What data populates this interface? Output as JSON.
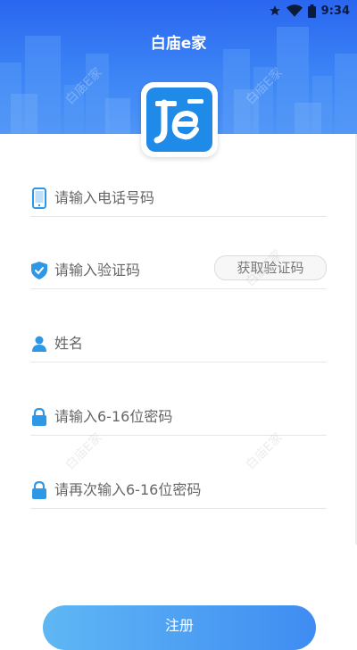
{
  "status_bar": {
    "time": "9:34",
    "icons": [
      "star-icon",
      "wifi-icon",
      "battery-icon"
    ]
  },
  "header": {
    "title": "白庙e家"
  },
  "form": {
    "phone_placeholder": "请输入电话号码",
    "code_placeholder": "请输入验证码",
    "get_code_label": "获取验证码",
    "name_placeholder": "姓名",
    "password_placeholder": "请输入6-16位密码",
    "confirm_password_placeholder": "请再次输入6-16位密码"
  },
  "actions": {
    "register_label": "注册"
  },
  "watermark": {
    "text": "白庙E家"
  },
  "colors": {
    "brand_blue": "#2a66f0",
    "icon_blue": "#2f98e6",
    "button_start": "#5fb7f4",
    "button_end": "#3f8cf2"
  }
}
